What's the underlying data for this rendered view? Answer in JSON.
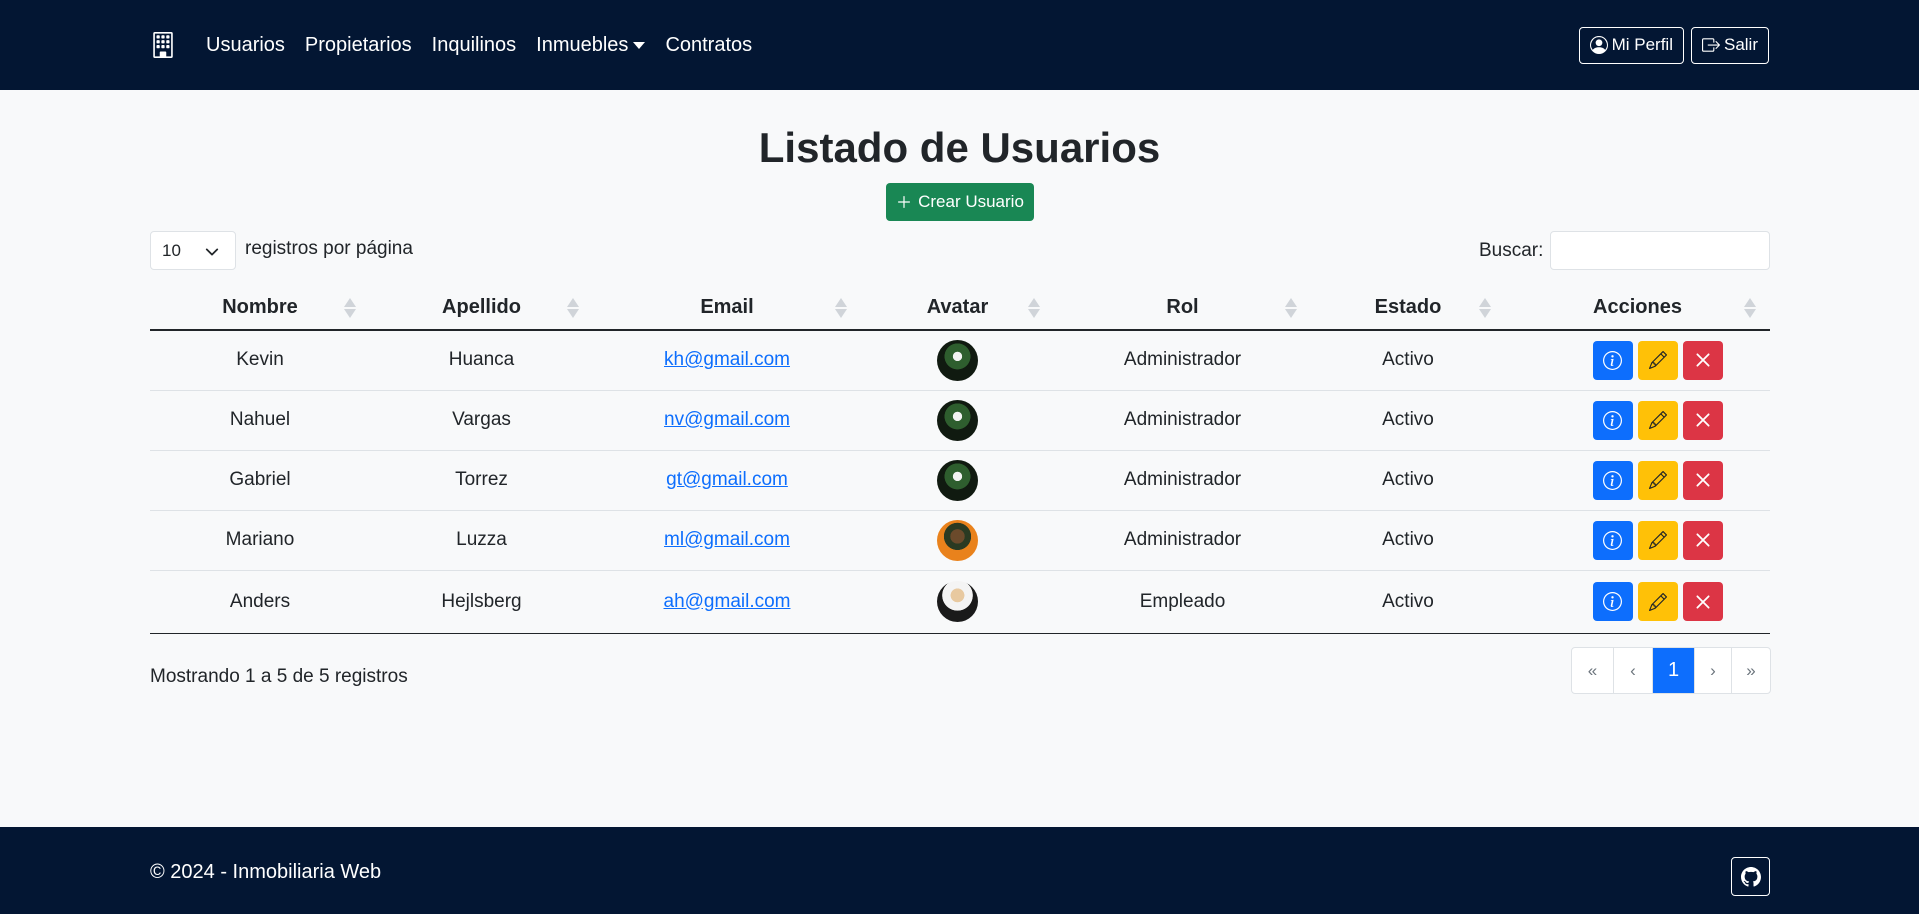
{
  "nav": {
    "brand_icon": "building-icon",
    "links": [
      "Usuarios",
      "Propietarios",
      "Inquilinos",
      "Inmuebles",
      "Contratos"
    ],
    "profile_label": "Mi Perfil",
    "logout_label": "Salir"
  },
  "page": {
    "title": "Listado de Usuarios",
    "create_label": "Crear Usuario"
  },
  "datatable": {
    "page_length": "10",
    "length_label": "registros por página",
    "search_label": "Buscar:",
    "search_value": "",
    "columns": [
      "Nombre",
      "Apellido",
      "Email",
      "Avatar",
      "Rol",
      "Estado",
      "Acciones"
    ],
    "rows": [
      {
        "nombre": "Kevin",
        "apellido": "Huanca",
        "email": "kh@gmail.com",
        "rol": "Administrador",
        "estado": "Activo"
      },
      {
        "nombre": "Nahuel",
        "apellido": "Vargas",
        "email": "nv@gmail.com",
        "rol": "Administrador",
        "estado": "Activo"
      },
      {
        "nombre": "Gabriel",
        "apellido": "Torrez",
        "email": "gt@gmail.com",
        "rol": "Administrador",
        "estado": "Activo"
      },
      {
        "nombre": "Mariano",
        "apellido": "Luzza",
        "email": "ml@gmail.com",
        "rol": "Administrador",
        "estado": "Activo"
      },
      {
        "nombre": "Anders",
        "apellido": "Hejlsberg",
        "email": "ah@gmail.com",
        "rol": "Empleado",
        "estado": "Activo"
      }
    ],
    "info": "Mostrando 1 a 5 de 5 registros",
    "pagination": [
      "«",
      "‹",
      "1",
      "›",
      "»"
    ]
  },
  "footer": {
    "text": "© 2024 - Inmobiliaria Web",
    "github_icon": "github-icon"
  },
  "colors": {
    "navbar": "#031633",
    "primary": "#0d6efd",
    "success": "#198754",
    "warning": "#ffc107",
    "danger": "#dc3545"
  }
}
